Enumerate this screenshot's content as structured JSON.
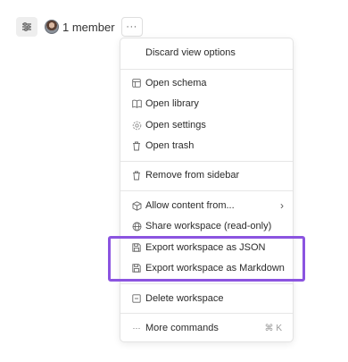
{
  "toolbar": {
    "filter_icon": "sliders-icon",
    "members_label": "1 member",
    "more_label": "···"
  },
  "menu": {
    "discard": "Discard view options",
    "open_schema": "Open schema",
    "open_library": "Open library",
    "open_settings": "Open settings",
    "open_trash": "Open trash",
    "remove_sidebar": "Remove from sidebar",
    "allow_content": "Allow content from...",
    "share_workspace": "Share workspace (read-only)",
    "export_json": "Export workspace as JSON",
    "export_markdown": "Export workspace as Markdown",
    "delete_workspace": "Delete workspace",
    "more_commands": "More commands",
    "more_commands_shortcut": "⌘ K",
    "more_commands_icon": "···"
  },
  "colors": {
    "highlight": "#8b54e0"
  }
}
